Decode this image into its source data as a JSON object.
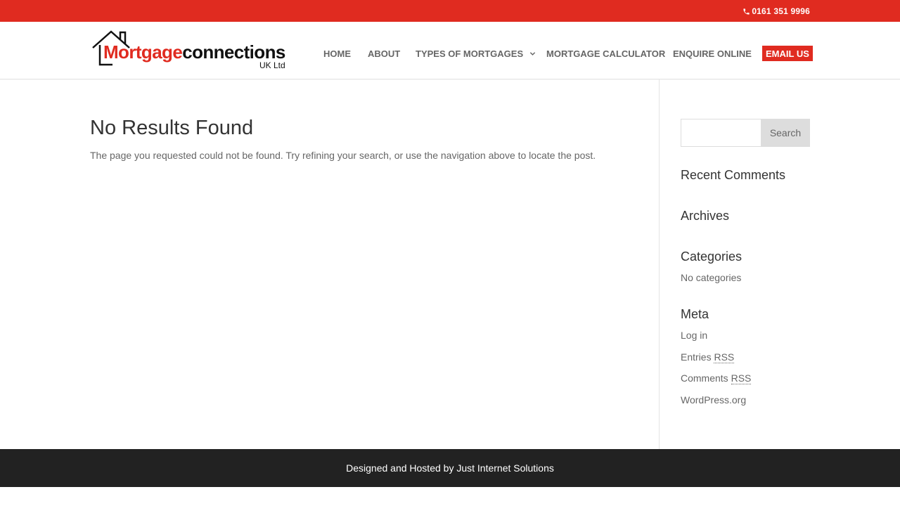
{
  "top_bar": {
    "phone_icon": "phone-icon",
    "phone": "0161 351 9996",
    "color": "#e02b20"
  },
  "logo": {
    "part_red": "Mortgage",
    "part_black": "connections",
    "sub": "UK Ltd",
    "icon": "house-icon"
  },
  "nav": {
    "items": [
      {
        "label": "HOME"
      },
      {
        "label": "ABOUT"
      },
      {
        "label": "TYPES OF MORTGAGES"
      },
      {
        "label": "MORTGAGE CALCULATOR"
      },
      {
        "label": "ENQUIRE ONLINE"
      },
      {
        "label": "EMAIL US"
      }
    ],
    "dropdown_icon": "chevron-down-icon"
  },
  "main": {
    "title": "No Results Found",
    "text": "The page you requested could not be found. Try refining your search, or use the navigation above to locate the post."
  },
  "sidebar": {
    "search": {
      "placeholder": "",
      "value": "",
      "button_label": "Search"
    },
    "recent_comments_title": "Recent Comments",
    "archives_title": "Archives",
    "categories_title": "Categories",
    "categories_empty": "No categories",
    "meta_title": "Meta",
    "meta_links": {
      "login": "Log in",
      "entries_prefix": "Entries ",
      "entries_abbr": "RSS",
      "comments_prefix": "Comments ",
      "comments_abbr": "RSS",
      "wordpress": "WordPress.org"
    }
  },
  "footer": {
    "text": "Designed and Hosted by Just Internet Solutions",
    "color": "#222222"
  }
}
